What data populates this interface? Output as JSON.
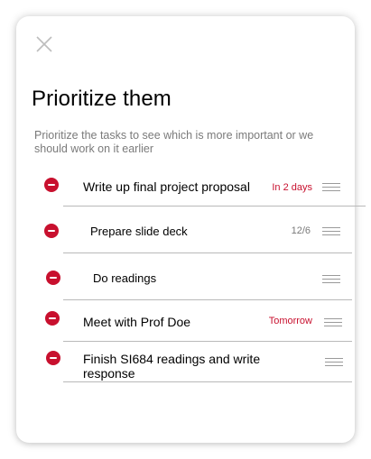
{
  "colors": {
    "accent_red": "#c8102e",
    "muted_text": "#7a7a7a",
    "divider": "#b9b9b9",
    "handle": "#9a9a9a"
  },
  "dialog": {
    "close_icon": "close-icon",
    "title": "Prioritize them",
    "subtitle": "Prioritize the tasks to see which is more important or we should work on it earlier"
  },
  "tasks": [
    {
      "label": "Write up final project proposal",
      "due": "In 2 days",
      "due_style": "urgent"
    },
    {
      "label": "Prepare slide deck",
      "due": "12/6",
      "due_style": "muted"
    },
    {
      "label": "Do readings",
      "due": "",
      "due_style": "muted"
    },
    {
      "label": "Meet with Prof Doe",
      "due": "Tomorrow",
      "due_style": "urgent"
    },
    {
      "label": "Finish SI684 readings and write response",
      "due": "",
      "due_style": "muted"
    }
  ]
}
